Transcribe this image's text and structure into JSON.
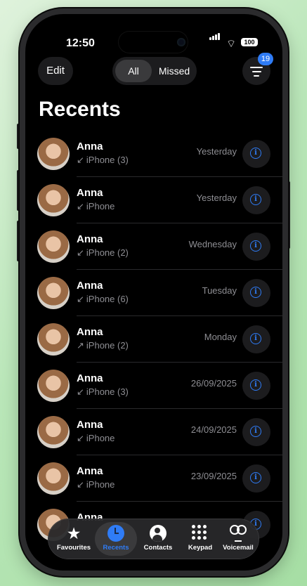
{
  "status_bar": {
    "time": "12:50",
    "battery": "100"
  },
  "header": {
    "edit_label": "Edit",
    "filter_all": "All",
    "filter_missed": "Missed",
    "badge_count": "19",
    "title": "Recents"
  },
  "calls": [
    {
      "name": "Anna",
      "direction": "incoming",
      "arrow": "↙",
      "detail": "iPhone (3)",
      "date": "Yesterday"
    },
    {
      "name": "Anna",
      "direction": "incoming",
      "arrow": "↙",
      "detail": "iPhone",
      "date": "Yesterday"
    },
    {
      "name": "Anna",
      "direction": "incoming",
      "arrow": "↙",
      "detail": "iPhone (2)",
      "date": "Wednesday"
    },
    {
      "name": "Anna",
      "direction": "incoming",
      "arrow": "↙",
      "detail": "iPhone (6)",
      "date": "Tuesday"
    },
    {
      "name": "Anna",
      "direction": "outgoing",
      "arrow": "↗",
      "detail": "iPhone (2)",
      "date": "Monday"
    },
    {
      "name": "Anna",
      "direction": "incoming",
      "arrow": "↙",
      "detail": "iPhone (3)",
      "date": "26/09/2025"
    },
    {
      "name": "Anna",
      "direction": "incoming",
      "arrow": "↙",
      "detail": "iPhone",
      "date": "24/09/2025"
    },
    {
      "name": "Anna",
      "direction": "incoming",
      "arrow": "↙",
      "detail": "iPhone",
      "date": "23/09/2025"
    },
    {
      "name": "Anna",
      "direction": "incoming",
      "arrow": "↙",
      "detail": "",
      "date": ""
    }
  ],
  "info_glyph": "i",
  "tabs": [
    {
      "label": "Favourites",
      "icon": "star-icon"
    },
    {
      "label": "Recents",
      "icon": "clock-icon"
    },
    {
      "label": "Contacts",
      "icon": "person-circle-icon"
    },
    {
      "label": "Keypad",
      "icon": "keypad-icon"
    },
    {
      "label": "Voicemail",
      "icon": "voicemail-icon"
    }
  ],
  "colors": {
    "accent": "#2f7cf6",
    "background": "#000000",
    "secondary_text": "#8e8e93"
  }
}
